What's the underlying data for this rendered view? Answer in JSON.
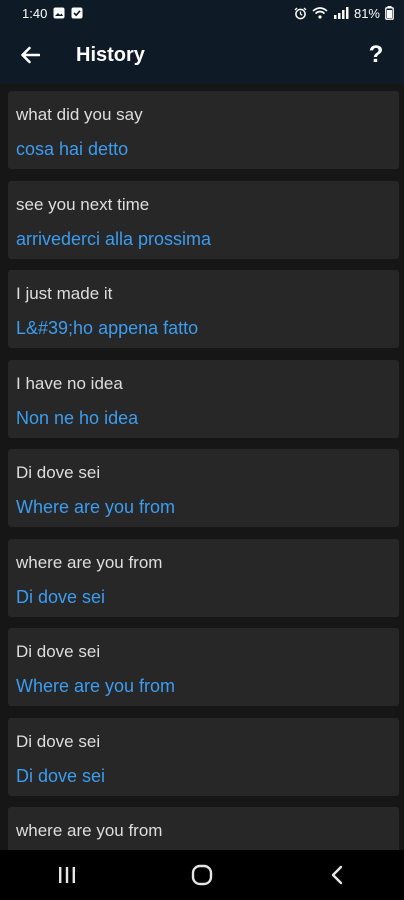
{
  "status_bar": {
    "time": "1:40",
    "battery": "81%",
    "icons": [
      "gallery-icon",
      "check-box-icon",
      "alarm-icon",
      "wifi-icon",
      "signal-icon",
      "battery-icon"
    ]
  },
  "app_bar": {
    "title": "History",
    "back_icon": "arrow-left-icon",
    "help_label": "?"
  },
  "history": {
    "items": [
      {
        "source": "what did you say",
        "translation": "cosa hai detto"
      },
      {
        "source": "see you next time",
        "translation": "arrivederci alla prossima"
      },
      {
        "source": "I just made it",
        "translation": "L&#39;ho appena fatto"
      },
      {
        "source": "I have no idea",
        "translation": "Non ne ho idea"
      },
      {
        "source": "Di dove sei",
        "translation": "Where are you from"
      },
      {
        "source": "where are you from",
        "translation": "Di dove sei"
      },
      {
        "source": "Di dove sei",
        "translation": "Where are you from"
      },
      {
        "source": "Di dove sei",
        "translation": "Di dove sei"
      },
      {
        "source": "where are you from",
        "translation": ""
      }
    ]
  },
  "colors": {
    "header_bg": "#0e1a26",
    "page_bg": "#161616",
    "card_bg": "#272727",
    "source_text": "#dedede",
    "translation_text": "#3b9cf0"
  },
  "nav_bar": {
    "icons": [
      "recent-apps-icon",
      "home-icon",
      "back-icon"
    ]
  }
}
